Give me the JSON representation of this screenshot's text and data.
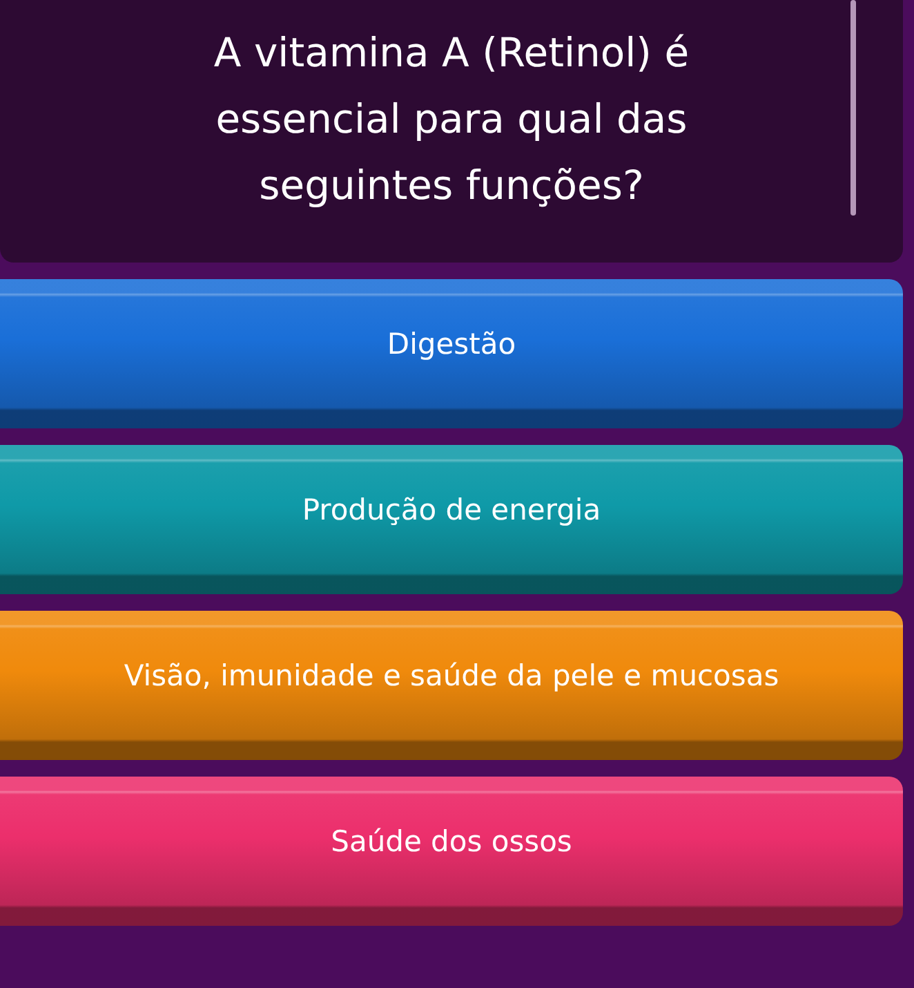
{
  "question": {
    "text": "A vitamina A (Retinol) é essencial para qual das seguintes funções?"
  },
  "options": [
    {
      "label": "Digestão",
      "color": "#1a6fd8"
    },
    {
      "label": "Produção de energia",
      "color": "#0f9aa8"
    },
    {
      "label": "Visão, imunidade e saúde da pele e mucosas",
      "color": "#f08a0c"
    },
    {
      "label": "Saúde dos ossos",
      "color": "#ec2f6c"
    }
  ]
}
